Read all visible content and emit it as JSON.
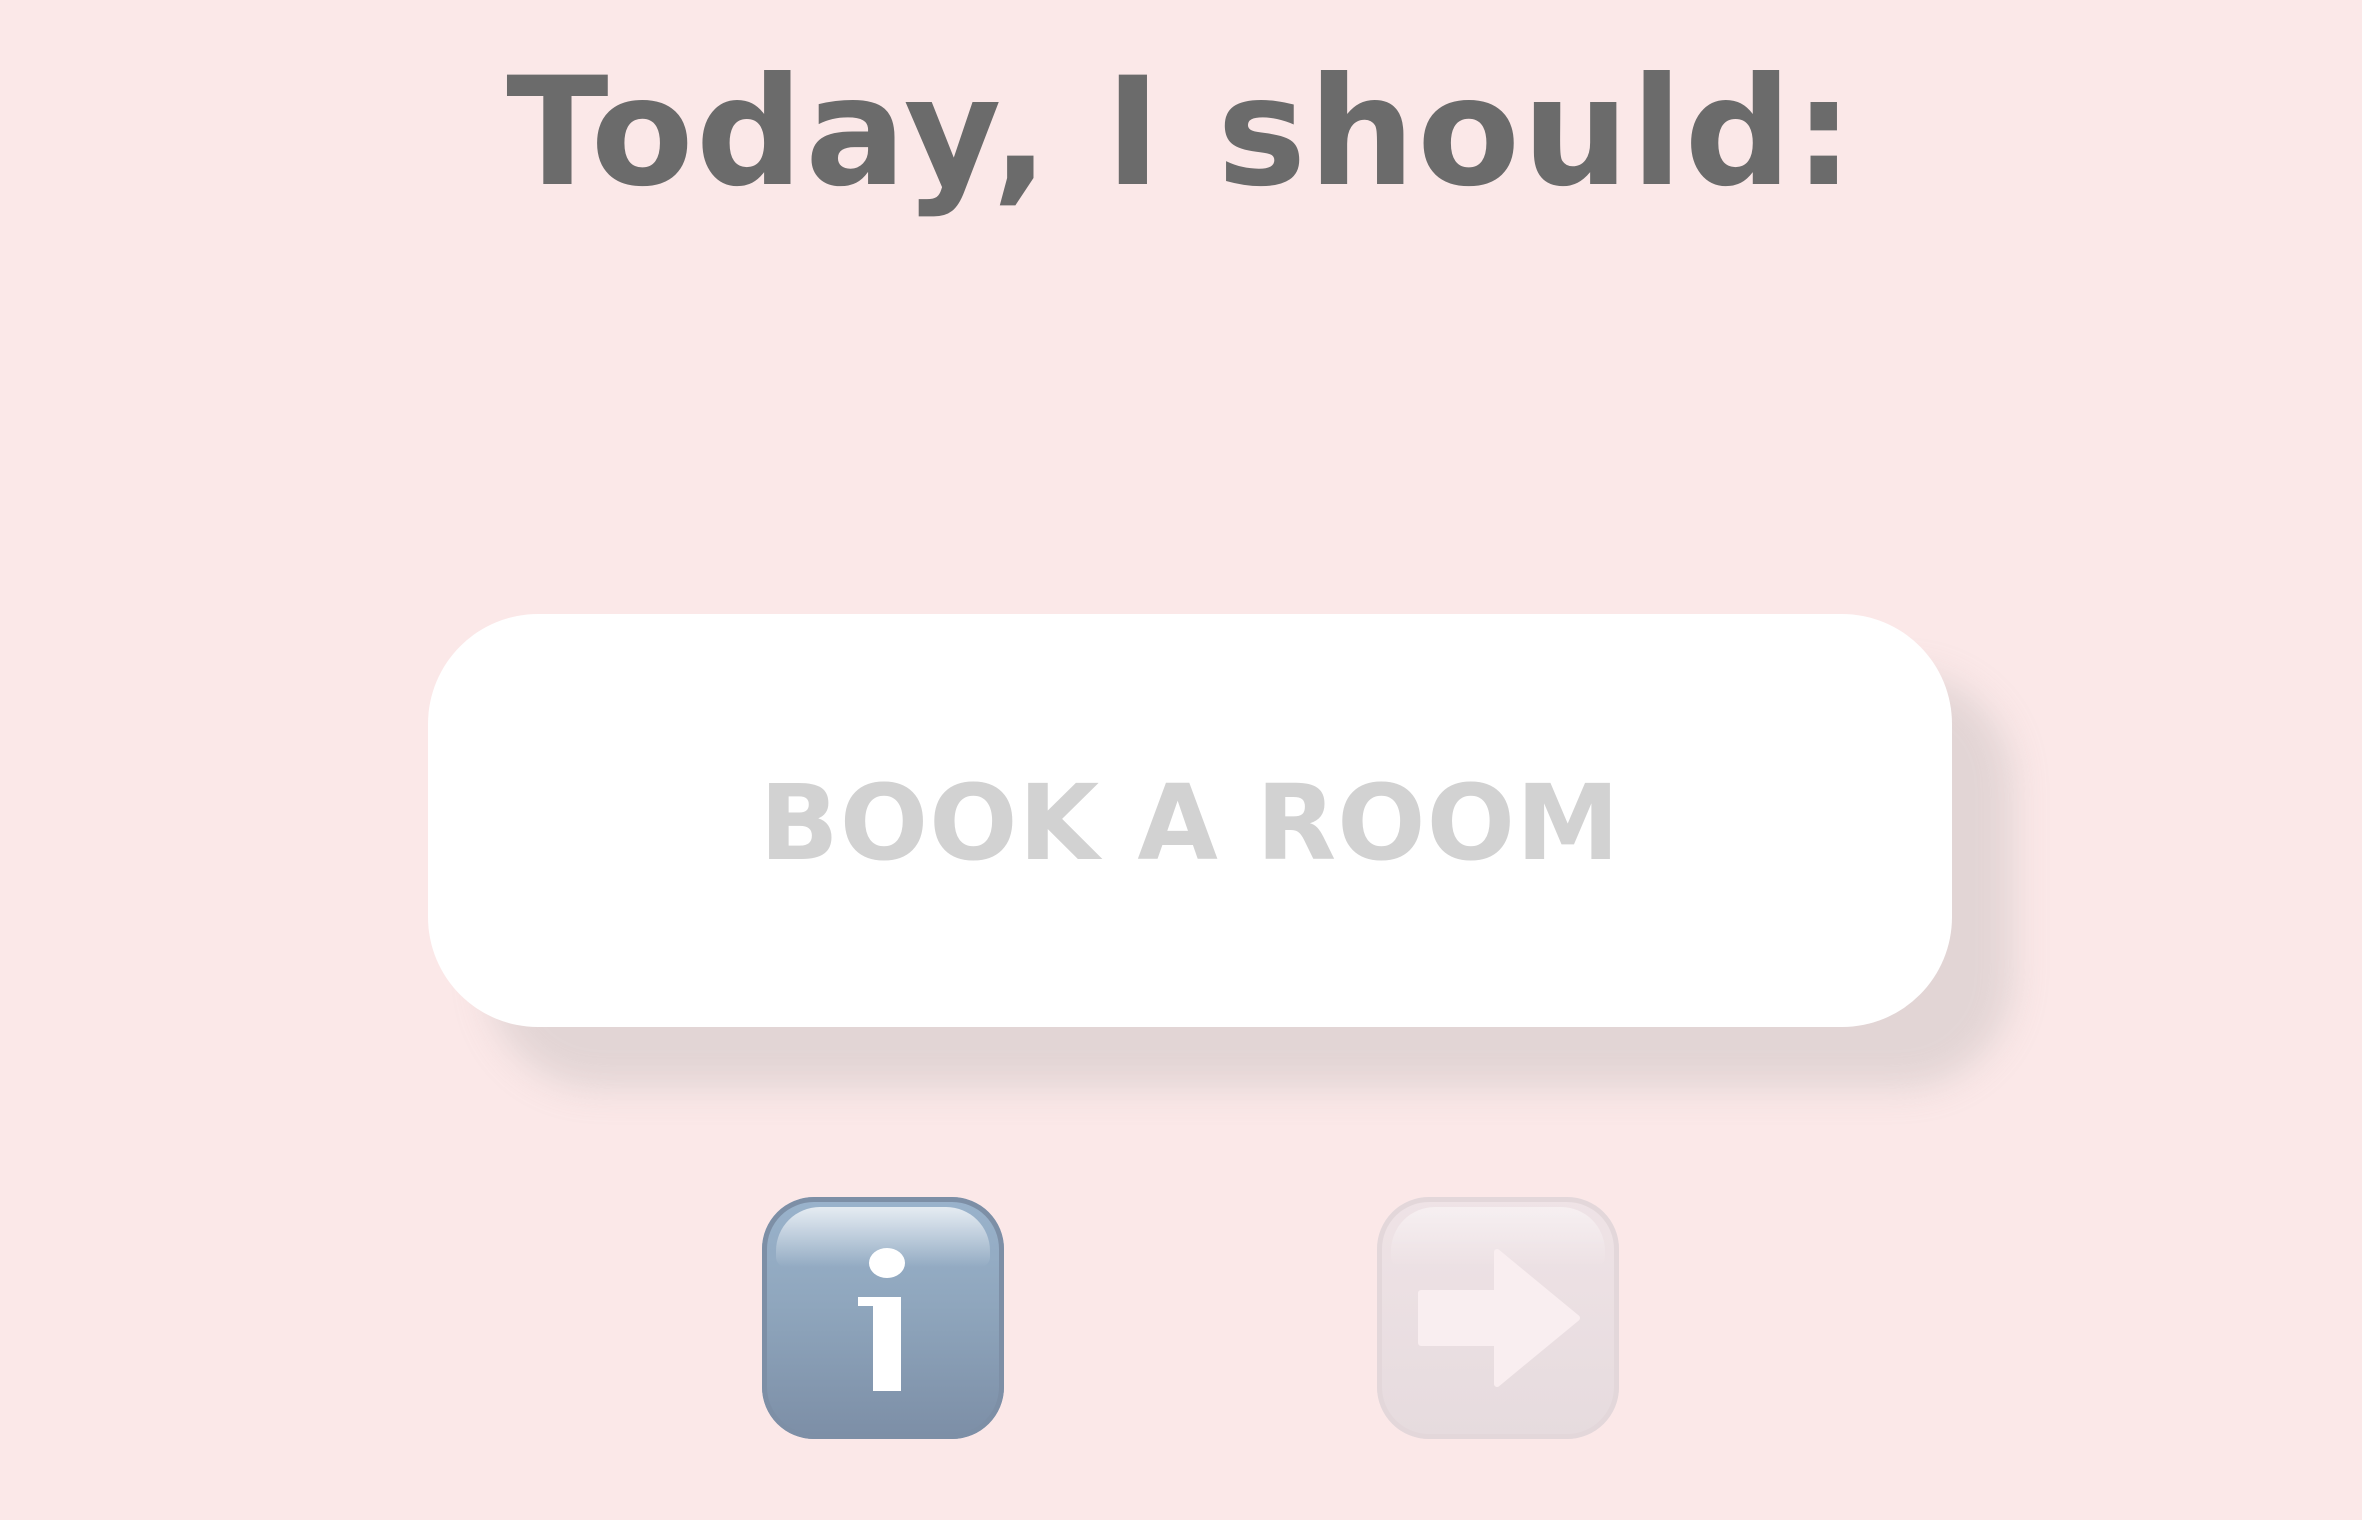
{
  "page": {
    "title": "Today, I should:",
    "background_color": "#fbe8e8"
  },
  "main_action": {
    "label": "BOOK A ROOM"
  },
  "toolbar": {
    "info_icon": "information-icon",
    "next_icon": "right-arrow-icon",
    "info_color": "#8fa6bd",
    "next_color": "#e6dbde"
  }
}
